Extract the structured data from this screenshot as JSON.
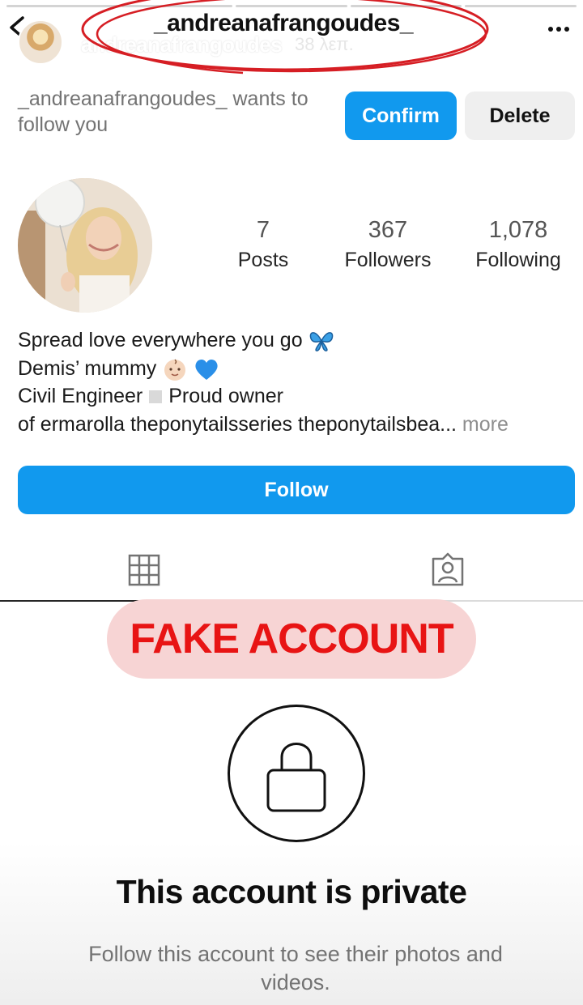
{
  "story": {
    "username": "andreanafrangoudes",
    "time": "38 λεπ."
  },
  "header": {
    "username": "_andreanafrangoudes_"
  },
  "follow_request": {
    "text": "_andreanafrangoudes_ wants to follow you",
    "confirm_label": "Confirm",
    "delete_label": "Delete"
  },
  "profile": {
    "stats": [
      {
        "value": "7",
        "label": "Posts"
      },
      {
        "value": "367",
        "label": "Followers"
      },
      {
        "value": "1,078",
        "label": "Following"
      }
    ],
    "bio": {
      "line1": "Spread love everywhere you go",
      "line2": "Demis’ mummy",
      "line3a": "Civil Engineer",
      "line3b": "Proud owner",
      "line4": "of ermarolla theponytailsseries theponytailsbea...",
      "more": "more"
    },
    "follow_label": "Follow"
  },
  "tabs": {
    "grid_icon": "grid-icon",
    "tagged_icon": "tagged-person-icon"
  },
  "overlay": {
    "fake_label": "FAKE ACCOUNT"
  },
  "private": {
    "title": "This account is private",
    "subtitle": "Follow this account to see their photos and videos."
  },
  "colors": {
    "accent_blue": "#1199ee",
    "fake_red": "#e81414",
    "fake_bg": "#f7d4d4",
    "annotation_red": "#d61e24"
  }
}
